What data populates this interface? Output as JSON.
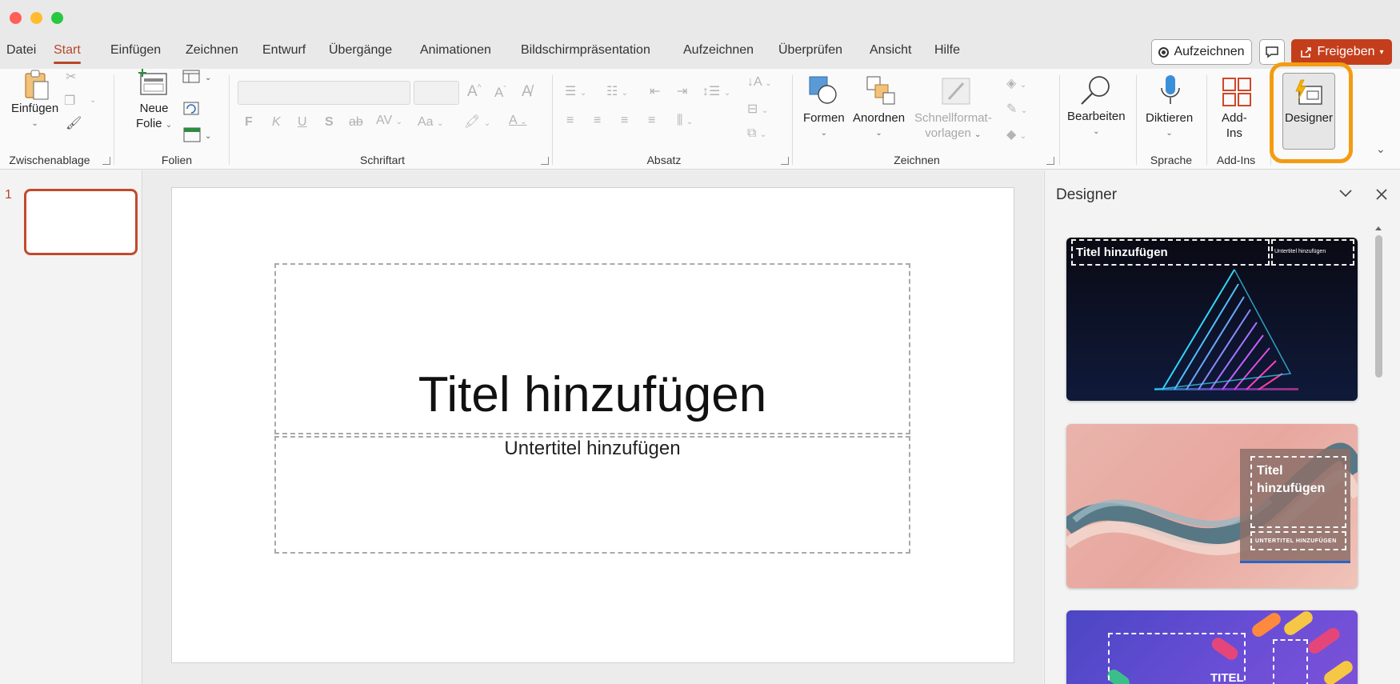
{
  "menu": {
    "tabs": [
      {
        "label": "Datei"
      },
      {
        "label": "Start"
      },
      {
        "label": "Einfügen"
      },
      {
        "label": "Zeichnen"
      },
      {
        "label": "Entwurf"
      },
      {
        "label": "Übergänge"
      },
      {
        "label": "Animationen"
      },
      {
        "label": "Bildschirmpräsentation"
      },
      {
        "label": "Aufzeichnen"
      },
      {
        "label": "Überprüfen"
      },
      {
        "label": "Ansicht"
      },
      {
        "label": "Hilfe"
      }
    ],
    "active_tab": "Start",
    "record_label": "Aufzeichnen",
    "share_label": "Freigeben"
  },
  "ribbon": {
    "groups": {
      "clipboard": "Zwischenablage",
      "slides": "Folien",
      "font": "Schriftart",
      "paragraph": "Absatz",
      "drawing": "Zeichnen",
      "language": "Sprache",
      "addins": "Add-Ins"
    },
    "buttons": {
      "paste": "Einfügen",
      "new_slide_1": "Neue",
      "new_slide_2": "Folie",
      "shapes": "Formen",
      "arrange": "Anordnen",
      "quick_styles_1": "Schnellformat-",
      "quick_styles_2": "vorlagen",
      "edit": "Bearbeiten",
      "dictate": "Diktieren",
      "addins_1": "Add-",
      "addins_2": "Ins",
      "designer": "Designer"
    },
    "font_glyphs": {
      "bold": "F",
      "italic": "K",
      "underline": "U",
      "shadow": "S",
      "strike": "ab",
      "spacing": "AV",
      "case": "Aa"
    }
  },
  "thumbnails": {
    "slide_number": "1"
  },
  "slide": {
    "title": "Titel hinzufügen",
    "subtitle": "Untertitel hinzufügen"
  },
  "designer_pane": {
    "title": "Designer",
    "cards": [
      {
        "title": "Titel hinzufügen",
        "subtitle": "Untertitel hinzufügen"
      },
      {
        "title_1": "Titel",
        "title_2": "hinzufügen",
        "subtitle": "UNTERTITEL HINZUFÜGEN"
      },
      {
        "title": "TITEL"
      }
    ]
  },
  "colors": {
    "accent": "#b7472a",
    "share": "#c43e1c",
    "highlight": "#f39c12"
  }
}
